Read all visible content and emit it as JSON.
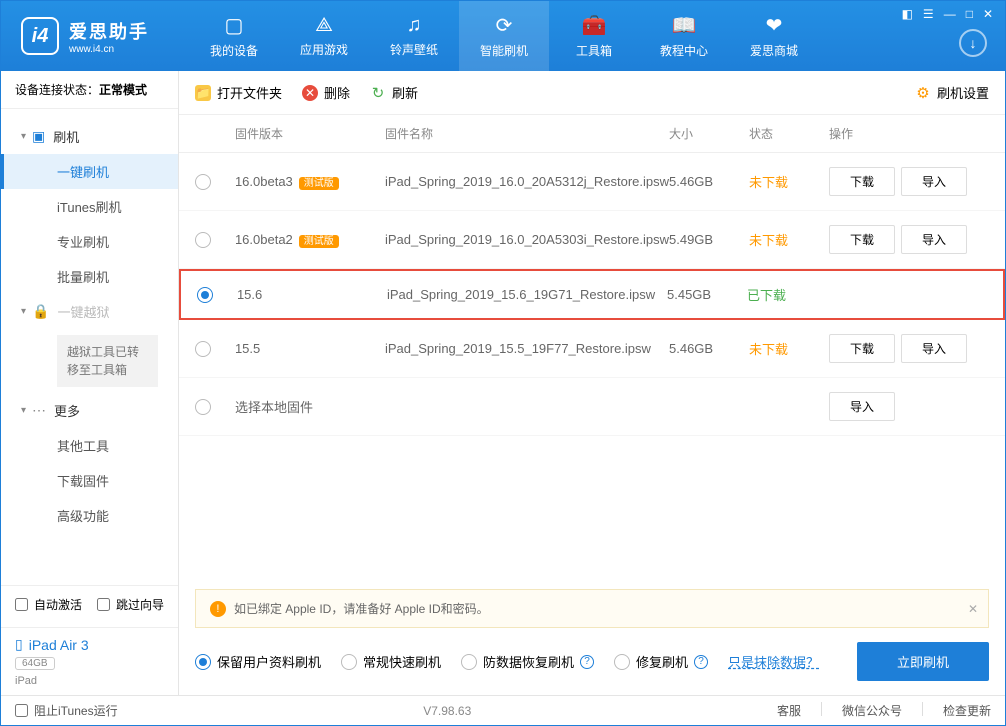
{
  "logo": {
    "title": "爱思助手",
    "sub": "www.i4.cn"
  },
  "nav": [
    {
      "label": "我的设备"
    },
    {
      "label": "应用游戏"
    },
    {
      "label": "铃声壁纸"
    },
    {
      "label": "智能刷机"
    },
    {
      "label": "工具箱"
    },
    {
      "label": "教程中心"
    },
    {
      "label": "爱思商城"
    }
  ],
  "sidebar": {
    "conn_label": "设备连接状态：",
    "conn_value": "正常模式",
    "flash_header": "刷机",
    "items_flash": [
      "一键刷机",
      "iTunes刷机",
      "专业刷机",
      "批量刷机"
    ],
    "jailbreak_header": "一键越狱",
    "jailbreak_note": "越狱工具已转移至工具箱",
    "more_header": "更多",
    "items_more": [
      "其他工具",
      "下载固件",
      "高级功能"
    ],
    "auto_activate": "自动激活",
    "skip_wizard": "跳过向导",
    "device_name": "iPad Air 3",
    "device_capacity": "64GB",
    "device_type": "iPad"
  },
  "toolbar": {
    "open": "打开文件夹",
    "delete": "删除",
    "refresh": "刷新",
    "settings": "刷机设置"
  },
  "columns": {
    "version": "固件版本",
    "name": "固件名称",
    "size": "大小",
    "status": "状态",
    "action": "操作"
  },
  "rows": [
    {
      "version": "16.0beta3",
      "badge": "测试版",
      "name": "iPad_Spring_2019_16.0_20A5312j_Restore.ipsw",
      "size": "5.46GB",
      "status": "未下载",
      "status_class": "not",
      "selected": false,
      "has_action": true
    },
    {
      "version": "16.0beta2",
      "badge": "测试版",
      "name": "iPad_Spring_2019_16.0_20A5303i_Restore.ipsw",
      "size": "5.49GB",
      "status": "未下载",
      "status_class": "not",
      "selected": false,
      "has_action": true
    },
    {
      "version": "15.6",
      "badge": "",
      "name": "iPad_Spring_2019_15.6_19G71_Restore.ipsw",
      "size": "5.45GB",
      "status": "已下载",
      "status_class": "done",
      "selected": true,
      "has_action": false,
      "highlighted": true
    },
    {
      "version": "15.5",
      "badge": "",
      "name": "iPad_Spring_2019_15.5_19F77_Restore.ipsw",
      "size": "5.46GB",
      "status": "未下载",
      "status_class": "not",
      "selected": false,
      "has_action": true
    }
  ],
  "local_row": "选择本地固件",
  "buttons": {
    "download": "下载",
    "import": "导入"
  },
  "info_bar": "如已绑定 Apple ID，请准备好 Apple ID和密码。",
  "options": {
    "keep_data": "保留用户资料刷机",
    "normal": "常规快速刷机",
    "anti": "防数据恢复刷机",
    "repair": "修复刷机",
    "erase_link": "只是抹除数据？",
    "flash_now": "立即刷机"
  },
  "footer": {
    "prevent": "阻止iTunes运行",
    "version": "V7.98.63",
    "service": "客服",
    "wechat": "微信公众号",
    "update": "检查更新"
  }
}
